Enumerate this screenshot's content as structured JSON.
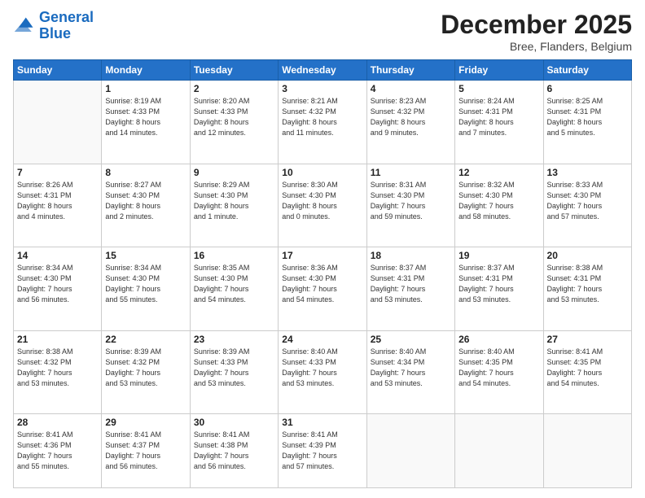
{
  "header": {
    "logo_line1": "General",
    "logo_line2": "Blue",
    "month_title": "December 2025",
    "location": "Bree, Flanders, Belgium"
  },
  "weekdays": [
    "Sunday",
    "Monday",
    "Tuesday",
    "Wednesday",
    "Thursday",
    "Friday",
    "Saturday"
  ],
  "weeks": [
    [
      {
        "day": "",
        "info": ""
      },
      {
        "day": "1",
        "info": "Sunrise: 8:19 AM\nSunset: 4:33 PM\nDaylight: 8 hours\nand 14 minutes."
      },
      {
        "day": "2",
        "info": "Sunrise: 8:20 AM\nSunset: 4:33 PM\nDaylight: 8 hours\nand 12 minutes."
      },
      {
        "day": "3",
        "info": "Sunrise: 8:21 AM\nSunset: 4:32 PM\nDaylight: 8 hours\nand 11 minutes."
      },
      {
        "day": "4",
        "info": "Sunrise: 8:23 AM\nSunset: 4:32 PM\nDaylight: 8 hours\nand 9 minutes."
      },
      {
        "day": "5",
        "info": "Sunrise: 8:24 AM\nSunset: 4:31 PM\nDaylight: 8 hours\nand 7 minutes."
      },
      {
        "day": "6",
        "info": "Sunrise: 8:25 AM\nSunset: 4:31 PM\nDaylight: 8 hours\nand 5 minutes."
      }
    ],
    [
      {
        "day": "7",
        "info": "Sunrise: 8:26 AM\nSunset: 4:31 PM\nDaylight: 8 hours\nand 4 minutes."
      },
      {
        "day": "8",
        "info": "Sunrise: 8:27 AM\nSunset: 4:30 PM\nDaylight: 8 hours\nand 2 minutes."
      },
      {
        "day": "9",
        "info": "Sunrise: 8:29 AM\nSunset: 4:30 PM\nDaylight: 8 hours\nand 1 minute."
      },
      {
        "day": "10",
        "info": "Sunrise: 8:30 AM\nSunset: 4:30 PM\nDaylight: 8 hours\nand 0 minutes."
      },
      {
        "day": "11",
        "info": "Sunrise: 8:31 AM\nSunset: 4:30 PM\nDaylight: 7 hours\nand 59 minutes."
      },
      {
        "day": "12",
        "info": "Sunrise: 8:32 AM\nSunset: 4:30 PM\nDaylight: 7 hours\nand 58 minutes."
      },
      {
        "day": "13",
        "info": "Sunrise: 8:33 AM\nSunset: 4:30 PM\nDaylight: 7 hours\nand 57 minutes."
      }
    ],
    [
      {
        "day": "14",
        "info": "Sunrise: 8:34 AM\nSunset: 4:30 PM\nDaylight: 7 hours\nand 56 minutes."
      },
      {
        "day": "15",
        "info": "Sunrise: 8:34 AM\nSunset: 4:30 PM\nDaylight: 7 hours\nand 55 minutes."
      },
      {
        "day": "16",
        "info": "Sunrise: 8:35 AM\nSunset: 4:30 PM\nDaylight: 7 hours\nand 54 minutes."
      },
      {
        "day": "17",
        "info": "Sunrise: 8:36 AM\nSunset: 4:30 PM\nDaylight: 7 hours\nand 54 minutes."
      },
      {
        "day": "18",
        "info": "Sunrise: 8:37 AM\nSunset: 4:31 PM\nDaylight: 7 hours\nand 53 minutes."
      },
      {
        "day": "19",
        "info": "Sunrise: 8:37 AM\nSunset: 4:31 PM\nDaylight: 7 hours\nand 53 minutes."
      },
      {
        "day": "20",
        "info": "Sunrise: 8:38 AM\nSunset: 4:31 PM\nDaylight: 7 hours\nand 53 minutes."
      }
    ],
    [
      {
        "day": "21",
        "info": "Sunrise: 8:38 AM\nSunset: 4:32 PM\nDaylight: 7 hours\nand 53 minutes."
      },
      {
        "day": "22",
        "info": "Sunrise: 8:39 AM\nSunset: 4:32 PM\nDaylight: 7 hours\nand 53 minutes."
      },
      {
        "day": "23",
        "info": "Sunrise: 8:39 AM\nSunset: 4:33 PM\nDaylight: 7 hours\nand 53 minutes."
      },
      {
        "day": "24",
        "info": "Sunrise: 8:40 AM\nSunset: 4:33 PM\nDaylight: 7 hours\nand 53 minutes."
      },
      {
        "day": "25",
        "info": "Sunrise: 8:40 AM\nSunset: 4:34 PM\nDaylight: 7 hours\nand 53 minutes."
      },
      {
        "day": "26",
        "info": "Sunrise: 8:40 AM\nSunset: 4:35 PM\nDaylight: 7 hours\nand 54 minutes."
      },
      {
        "day": "27",
        "info": "Sunrise: 8:41 AM\nSunset: 4:35 PM\nDaylight: 7 hours\nand 54 minutes."
      }
    ],
    [
      {
        "day": "28",
        "info": "Sunrise: 8:41 AM\nSunset: 4:36 PM\nDaylight: 7 hours\nand 55 minutes."
      },
      {
        "day": "29",
        "info": "Sunrise: 8:41 AM\nSunset: 4:37 PM\nDaylight: 7 hours\nand 56 minutes."
      },
      {
        "day": "30",
        "info": "Sunrise: 8:41 AM\nSunset: 4:38 PM\nDaylight: 7 hours\nand 56 minutes."
      },
      {
        "day": "31",
        "info": "Sunrise: 8:41 AM\nSunset: 4:39 PM\nDaylight: 7 hours\nand 57 minutes."
      },
      {
        "day": "",
        "info": ""
      },
      {
        "day": "",
        "info": ""
      },
      {
        "day": "",
        "info": ""
      }
    ]
  ]
}
